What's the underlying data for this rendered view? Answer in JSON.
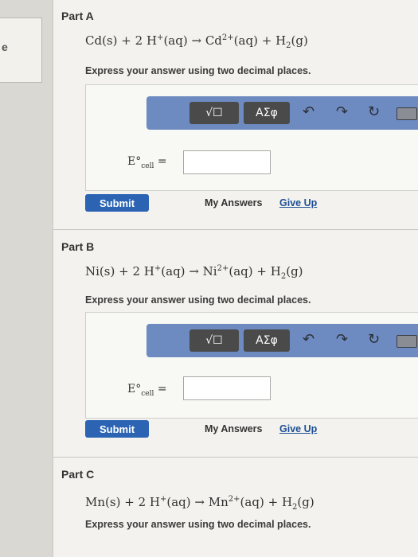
{
  "side_panel": {
    "text": "e"
  },
  "parts": [
    {
      "title": "Part A",
      "equation": {
        "reactant1": "Cd(s)",
        "plus1": "+",
        "coef": "2",
        "h": "H",
        "h_sup": "+",
        "aq1": "(aq)",
        "arrow": "→",
        "ion": "Cd",
        "ion_sup": "2+",
        "aq2": "(aq)",
        "plus2": "+",
        "h2": "H",
        "h2_sub": "2",
        "g": "(g)"
      },
      "instruction": "Express your answer using two decimal places.",
      "label_e": "E°",
      "label_sub": "cell",
      "label_eq": "=",
      "submit": "Submit",
      "my_answers": "My Answers",
      "give_up": "Give Up"
    },
    {
      "title": "Part B",
      "equation": {
        "reactant1": "Ni(s)",
        "plus1": "+",
        "coef": "2",
        "h": "H",
        "h_sup": "+",
        "aq1": "(aq)",
        "arrow": "→",
        "ion": "Ni",
        "ion_sup": "2+",
        "aq2": "(aq)",
        "plus2": "+",
        "h2": "H",
        "h2_sub": "2",
        "g": "(g)"
      },
      "instruction": "Express your answer using two decimal places.",
      "label_e": "E°",
      "label_sub": "cell",
      "label_eq": "=",
      "submit": "Submit",
      "my_answers": "My Answers",
      "give_up": "Give Up"
    },
    {
      "title": "Part C",
      "equation": {
        "reactant1": "Mn(s)",
        "plus1": "+",
        "coef": "2",
        "h": "H",
        "h_sup": "+",
        "aq1": "(aq)",
        "arrow": "→",
        "ion": "Mn",
        "ion_sup": "2+",
        "aq2": "(aq)",
        "plus2": "+",
        "h2": "H",
        "h2_sub": "2",
        "g": "(g)"
      },
      "instruction": "Express your answer using two decimal places."
    }
  ],
  "toolbar": {
    "templates_label": "√☐",
    "greek_label": "ΑΣφ",
    "undo_icon": "↶",
    "redo_icon": "↷",
    "reset_icon": "↻",
    "help_label": "?"
  },
  "colors": {
    "toolbar": "#6d8bc0",
    "submit": "#2c64b3",
    "link": "#1d4f94"
  }
}
